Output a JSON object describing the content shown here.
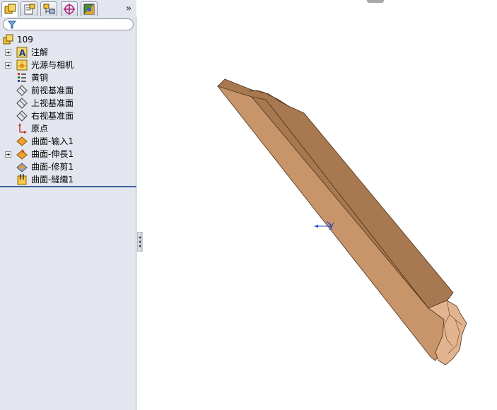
{
  "tabs": [
    {
      "name": "featuremanager",
      "active": true
    },
    {
      "name": "propertymanager",
      "active": false
    },
    {
      "name": "configurationmanager",
      "active": false
    },
    {
      "name": "dimxpert",
      "active": false
    },
    {
      "name": "display-manager",
      "active": false
    }
  ],
  "expand_symbol": "»",
  "tree": {
    "root_label": "109",
    "items": [
      {
        "label": "注解",
        "icon": "annotation-icon",
        "expandable": true
      },
      {
        "label": "光源与相机",
        "icon": "lights-cameras-icon",
        "expandable": true
      },
      {
        "label": "黄铜",
        "icon": "material-icon",
        "expandable": false
      },
      {
        "label": "前视基准面",
        "icon": "plane-icon",
        "expandable": false
      },
      {
        "label": "上视基准面",
        "icon": "plane-icon",
        "expandable": false
      },
      {
        "label": "右视基准面",
        "icon": "plane-icon",
        "expandable": false
      },
      {
        "label": "原点",
        "icon": "origin-icon",
        "expandable": false
      },
      {
        "label": "曲面-输入1",
        "icon": "surface-import-icon",
        "expandable": false
      },
      {
        "label": "曲面-伸長1",
        "icon": "surface-extend-icon",
        "expandable": true
      },
      {
        "label": "曲面-修剪1",
        "icon": "surface-trim-icon",
        "expandable": false
      },
      {
        "label": "曲面-縫織1",
        "icon": "surface-knit-icon",
        "expandable": false
      }
    ]
  },
  "colors": {
    "panel_bg": "#e3e6ee",
    "rollback_bar": "#3a5fa0",
    "part_top": "#c8956a",
    "part_side": "#a87950",
    "origin": "#1f3fd0"
  }
}
